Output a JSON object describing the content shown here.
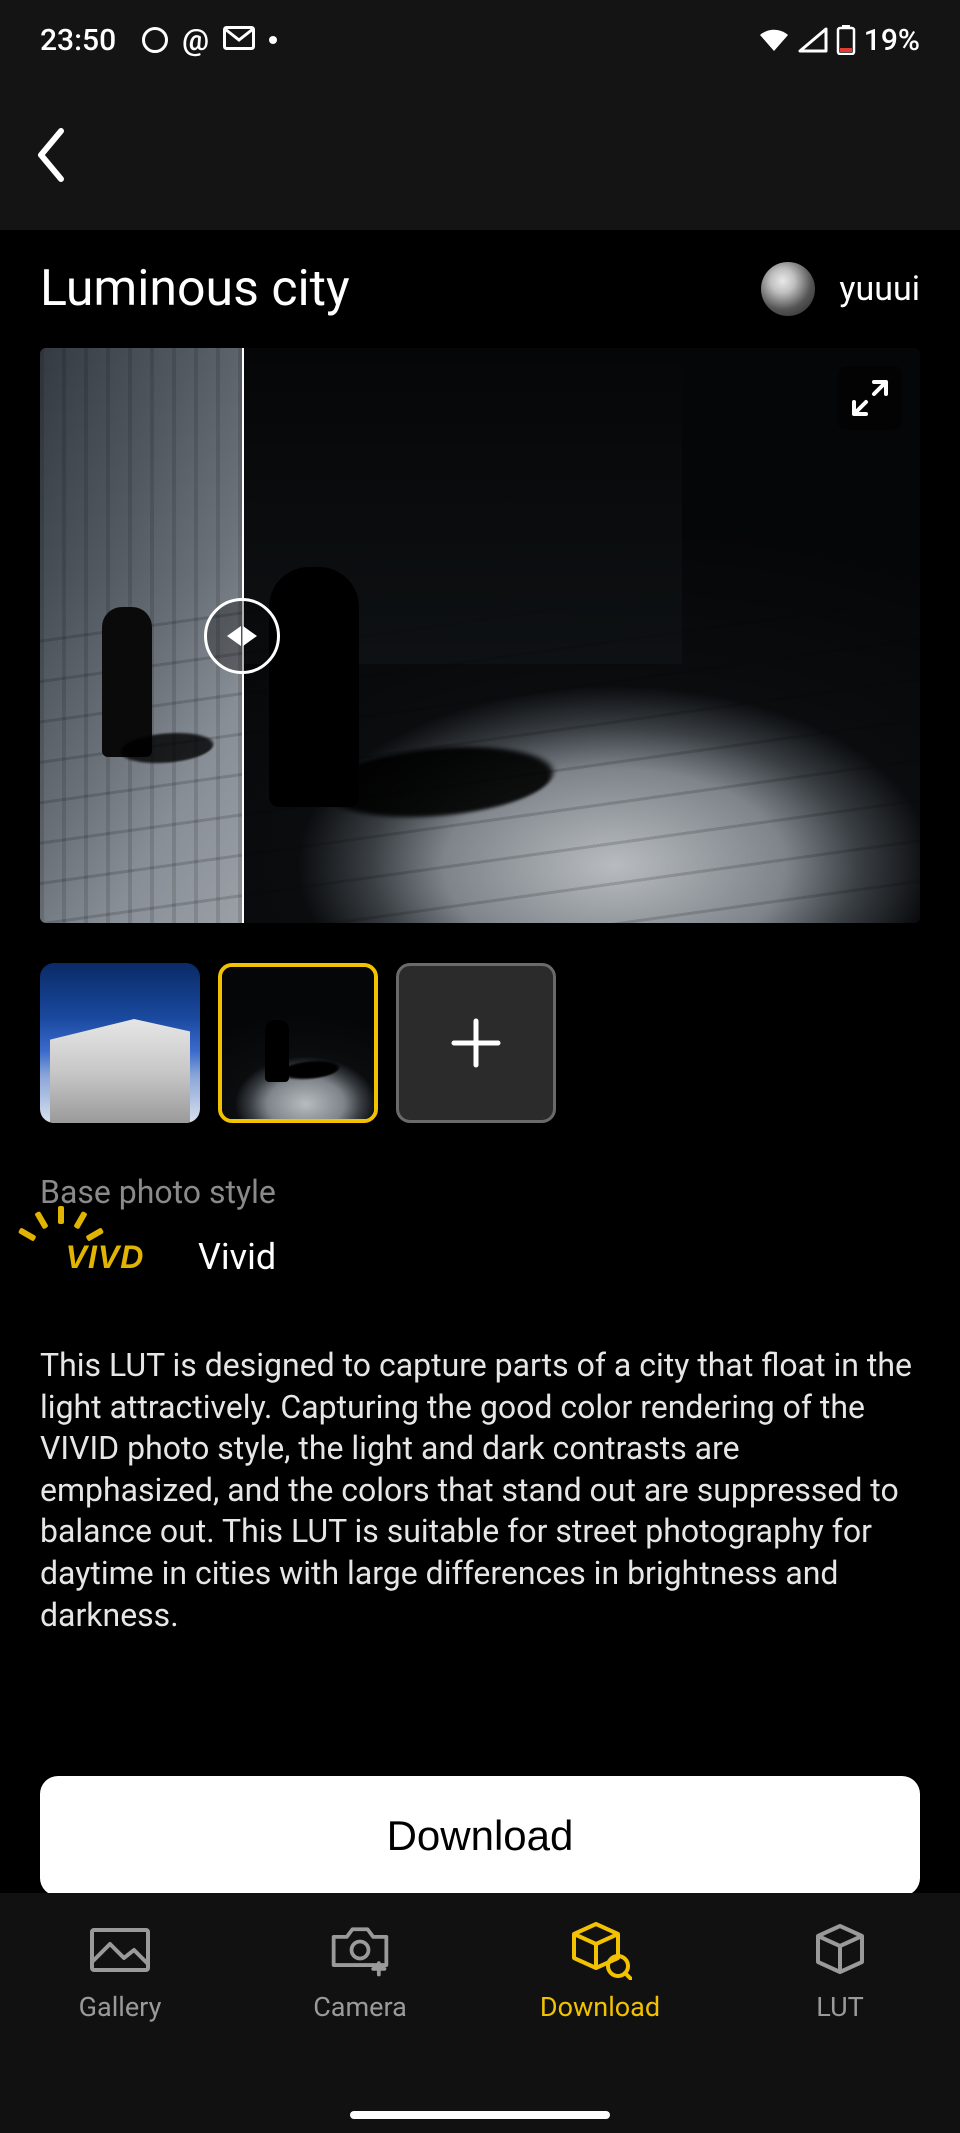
{
  "status": {
    "time": "23:50",
    "battery_pct": "19%"
  },
  "header": {
    "title": "Luminous city",
    "author": "yuuui"
  },
  "thumbnails": {
    "selected_index": 1
  },
  "base_style": {
    "section_label": "Base photo style",
    "badge_text": "VIVD",
    "style_name": "Vivid"
  },
  "description": "This LUT is designed to capture parts of a city that float in the light attractively. Capturing the good color rendering of the VIVID photo style, the light and dark contrasts are emphasized, and the colors that stand out are suppressed to balance out. This LUT is suitable for street photography for daytime in cities with large differences in brightness and darkness.",
  "actions": {
    "download": "Download"
  },
  "nav": {
    "gallery": "Gallery",
    "camera": "Camera",
    "download": "Download",
    "lut": "LUT",
    "active": "download"
  },
  "colors": {
    "accent": "#f2c200"
  }
}
